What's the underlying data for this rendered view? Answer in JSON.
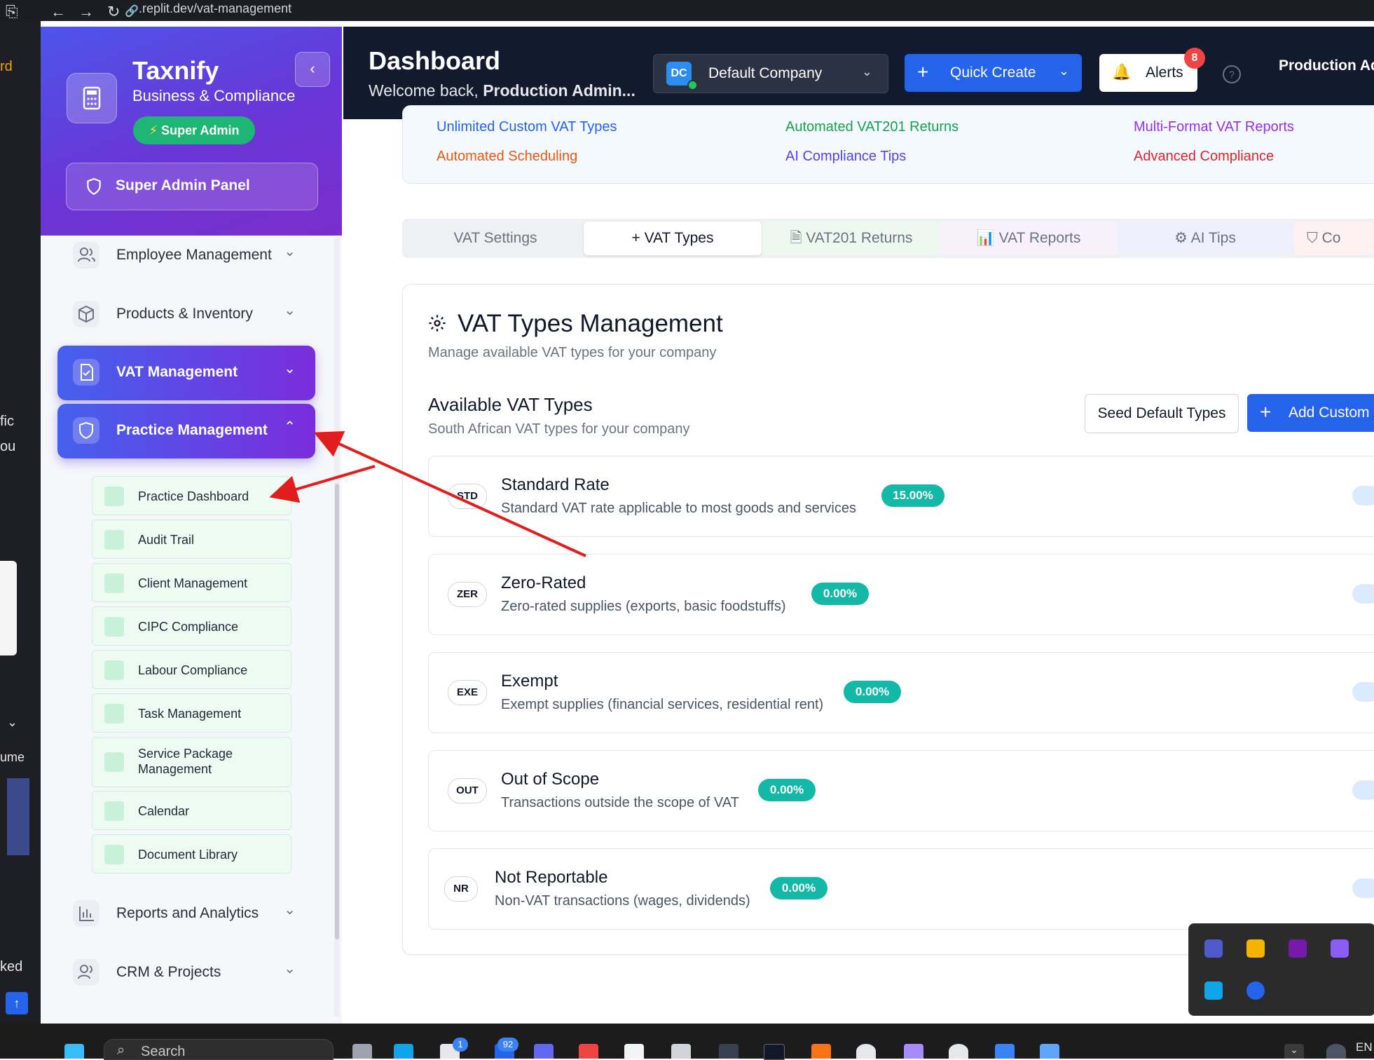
{
  "browser": {
    "url": ".replit.dev/vat-management"
  },
  "left_strip": {
    "fragments": [
      "rd",
      "fic",
      "ou",
      "ume",
      "ked"
    ]
  },
  "sidebar": {
    "brand": "Taxnify",
    "subtitle": "Business & Compliance",
    "role_badge": "Super Admin",
    "admin_panel": "Super Admin Panel",
    "items": [
      {
        "label": "Employee Management",
        "icon": "users-icon"
      },
      {
        "label": "Products & Inventory",
        "icon": "package-icon"
      },
      {
        "label": "VAT Management",
        "icon": "file-check-icon"
      },
      {
        "label": "Practice Management",
        "icon": "shield-icon"
      },
      {
        "label": "Reports and Analytics",
        "icon": "bar-chart-icon"
      },
      {
        "label": "CRM & Projects",
        "icon": "users-icon"
      }
    ],
    "practice_subitems": [
      "Practice Dashboard",
      "Audit Trail",
      "Client Management",
      "CIPC Compliance",
      "Labour Compliance",
      "Task Management",
      "Service Package Management",
      "Calendar",
      "Document Library"
    ]
  },
  "header": {
    "title": "Dashboard",
    "welcome_prefix": "Welcome back, ",
    "welcome_name": "Production Admin...",
    "company_initials": "DC",
    "company": "Default Company",
    "quick_create": "Quick Create",
    "alerts": "Alerts",
    "alerts_count": "8",
    "help": "?",
    "user": "Production Ad"
  },
  "features": [
    {
      "label": "Unlimited Custom VAT Types",
      "color": "#2563eb"
    },
    {
      "label": "Automated VAT201 Returns",
      "color": "#16a34a"
    },
    {
      "label": "Multi-Format VAT Reports",
      "color": "#9333ea"
    },
    {
      "label": "Automated Scheduling",
      "color": "#ea580c"
    },
    {
      "label": "AI Compliance Tips",
      "color": "#4f46e5"
    },
    {
      "label": "Advanced Compliance",
      "color": "#dc2626"
    }
  ],
  "tabs": [
    {
      "label": "VAT Settings",
      "icon": ""
    },
    {
      "label": "VAT Types",
      "icon": "+"
    },
    {
      "label": "VAT201 Returns",
      "icon": "document-icon"
    },
    {
      "label": "VAT Reports",
      "icon": "bar-chart-icon"
    },
    {
      "label": "AI Tips",
      "icon": "brain-icon"
    },
    {
      "label": "Co",
      "icon": "shield-icon"
    }
  ],
  "vat_types_card": {
    "title": "VAT Types Management",
    "subtitle": "Manage available VAT types for your company",
    "section_title": "Available VAT Types",
    "section_subtitle": "South African VAT types for your company",
    "seed_button": "Seed Default Types",
    "add_button": "Add Custom",
    "rows": [
      {
        "code": "STD",
        "name": "Standard Rate",
        "description": "Standard VAT rate applicable to most goods and services",
        "rate": "15.00%"
      },
      {
        "code": "ZER",
        "name": "Zero-Rated",
        "description": "Zero-rated supplies (exports, basic foodstuffs)",
        "rate": "0.00%"
      },
      {
        "code": "EXE",
        "name": "Exempt",
        "description": "Exempt supplies (financial services, residential rent)",
        "rate": "0.00%"
      },
      {
        "code": "OUT",
        "name": "Out of Scope",
        "description": "Transactions outside the scope of VAT",
        "rate": "0.00%"
      },
      {
        "code": "NR",
        "name": "Not Reportable",
        "description": "Non-VAT transactions (wages, dividends)",
        "rate": "0.00%"
      }
    ]
  },
  "taskbar": {
    "search": "Search",
    "badge_a": "1",
    "badge_b": "92",
    "language": "EN"
  },
  "annotation_color": "#e11d1d"
}
